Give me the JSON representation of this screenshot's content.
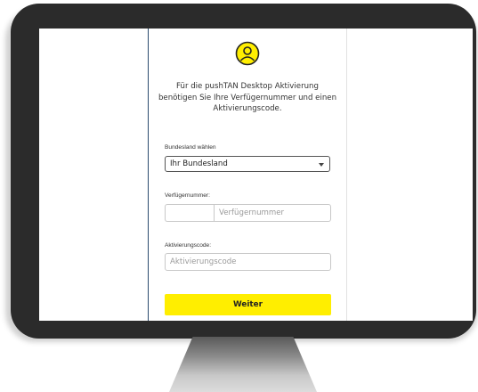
{
  "colors": {
    "accent": "#ffee00",
    "frame": "#2b2b2b",
    "panel_border": "#2b4b6f"
  },
  "icon": "user-circle-icon",
  "intro_text": "Für die pushTAN Desktop Aktivierung benötigen Sie Ihre Verfügernummer und einen Aktivierungscode.",
  "form": {
    "bundesland": {
      "label": "Bundesland wählen",
      "selected": "Ihr Bundesland"
    },
    "verfuegernummer": {
      "label": "Verfügernummer:",
      "prefix_value": "",
      "placeholder": "Verfügernummer"
    },
    "aktivierungscode": {
      "label": "Aktivierungscode:",
      "placeholder": "Aktivierungscode"
    },
    "submit_label": "Weiter"
  }
}
